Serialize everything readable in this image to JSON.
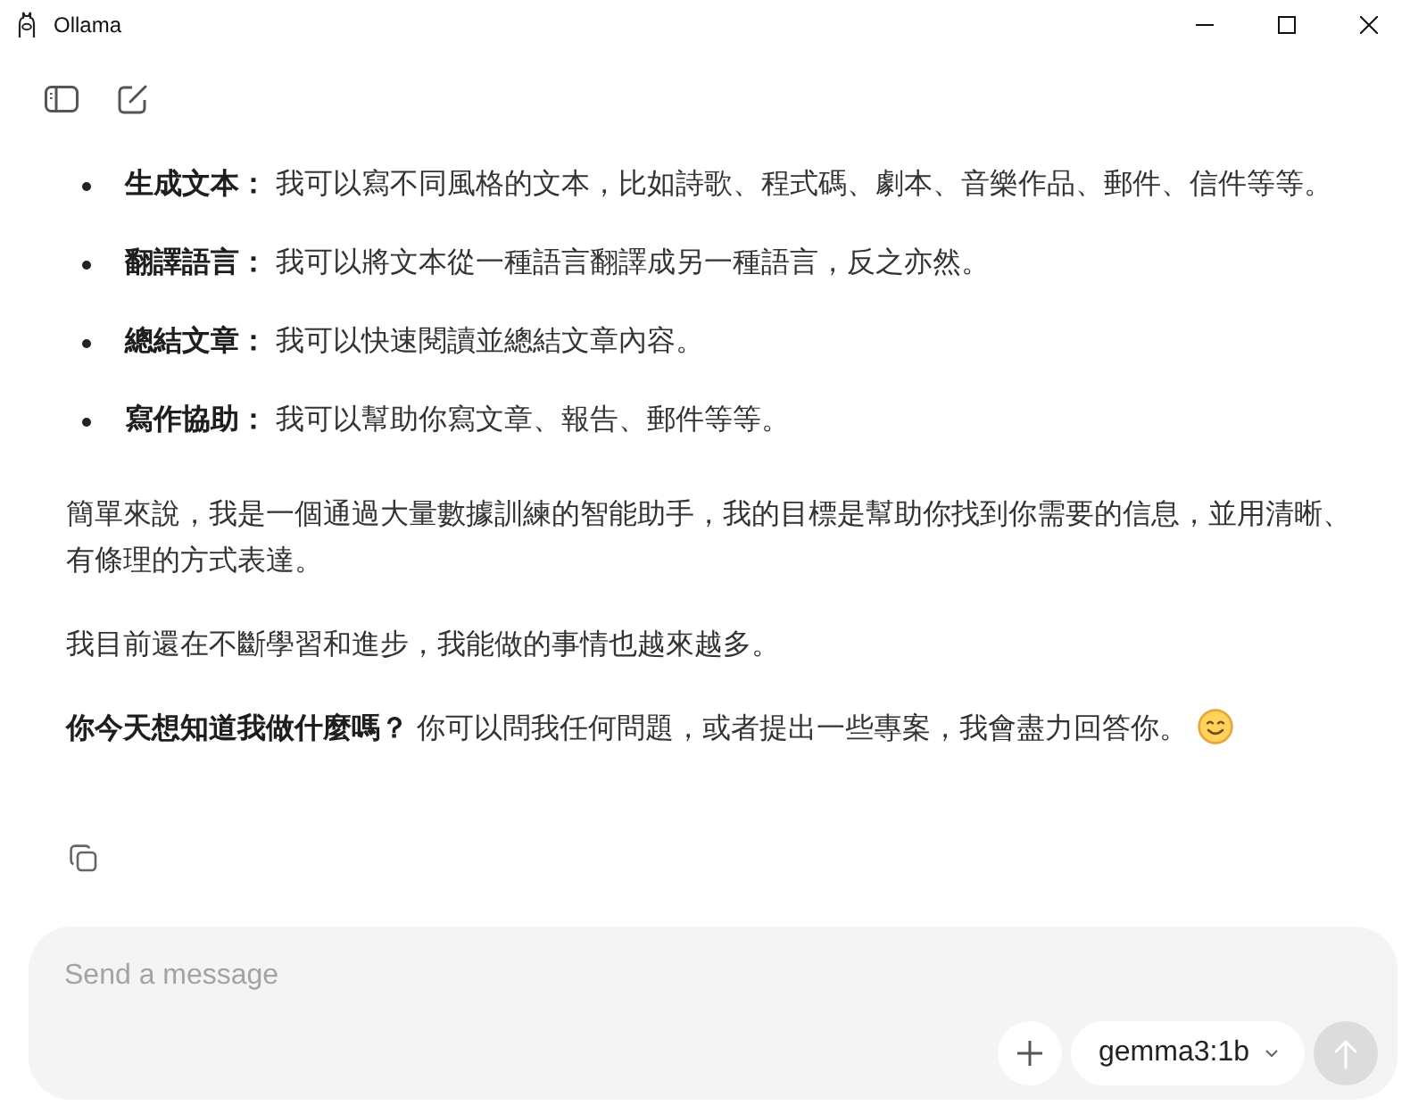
{
  "window": {
    "title": "Ollama"
  },
  "chat": {
    "bullets": [
      "**生成文本：** 我可以寫不同風格的文本，比如詩歌、程式碼、劇本、音樂作品、郵件、信件等等。",
      "**翻譯語言：** 我可以將文本從一種語言翻譯成另一種語言，反之亦然。",
      "**總結文章：** 我可以快速閱讀並總結文章內容。",
      "**寫作協助：** 我可以幫助你寫文章、報告、郵件等等。"
    ],
    "paragraphs": [
      "簡單來說，我是一個通過大量數據訓練的智能助手，我的目標是幫助你找到你需要的信息，並用清晰、有條理的方式表達。",
      "我目前還在不斷學習和進步，我能做的事情也越來越多。",
      "**你今天想知道我做什麼嗎？** 你可以問我任何問題，或者提出一些專案，我會盡力回答你。"
    ]
  },
  "composer": {
    "placeholder": "Send a message",
    "model": "gemma3:1b",
    "send_button": {
      "disabled": true
    }
  }
}
